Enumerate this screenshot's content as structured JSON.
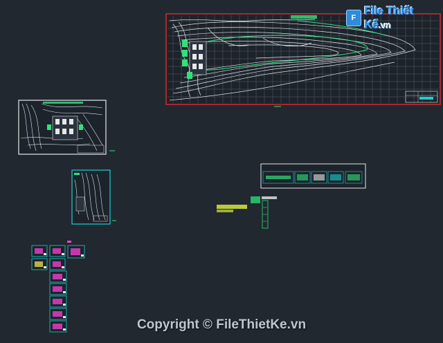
{
  "logo": {
    "brand_main": "File Thiết Kế",
    "brand_suffix": ".vn"
  },
  "watermark": {
    "copyright": "Copyright © FileThietKe.vn"
  },
  "colors": {
    "background": "#212830",
    "sheet_frame": "#e8e8e8",
    "site_frame": "#d42a2a",
    "detail_frame": "#16d2d2",
    "contour": "#e0e6ee",
    "accent_green": "#2ee37a",
    "accent_magenta": "#ff3fd8",
    "accent_yellow": "#f0e14a"
  }
}
